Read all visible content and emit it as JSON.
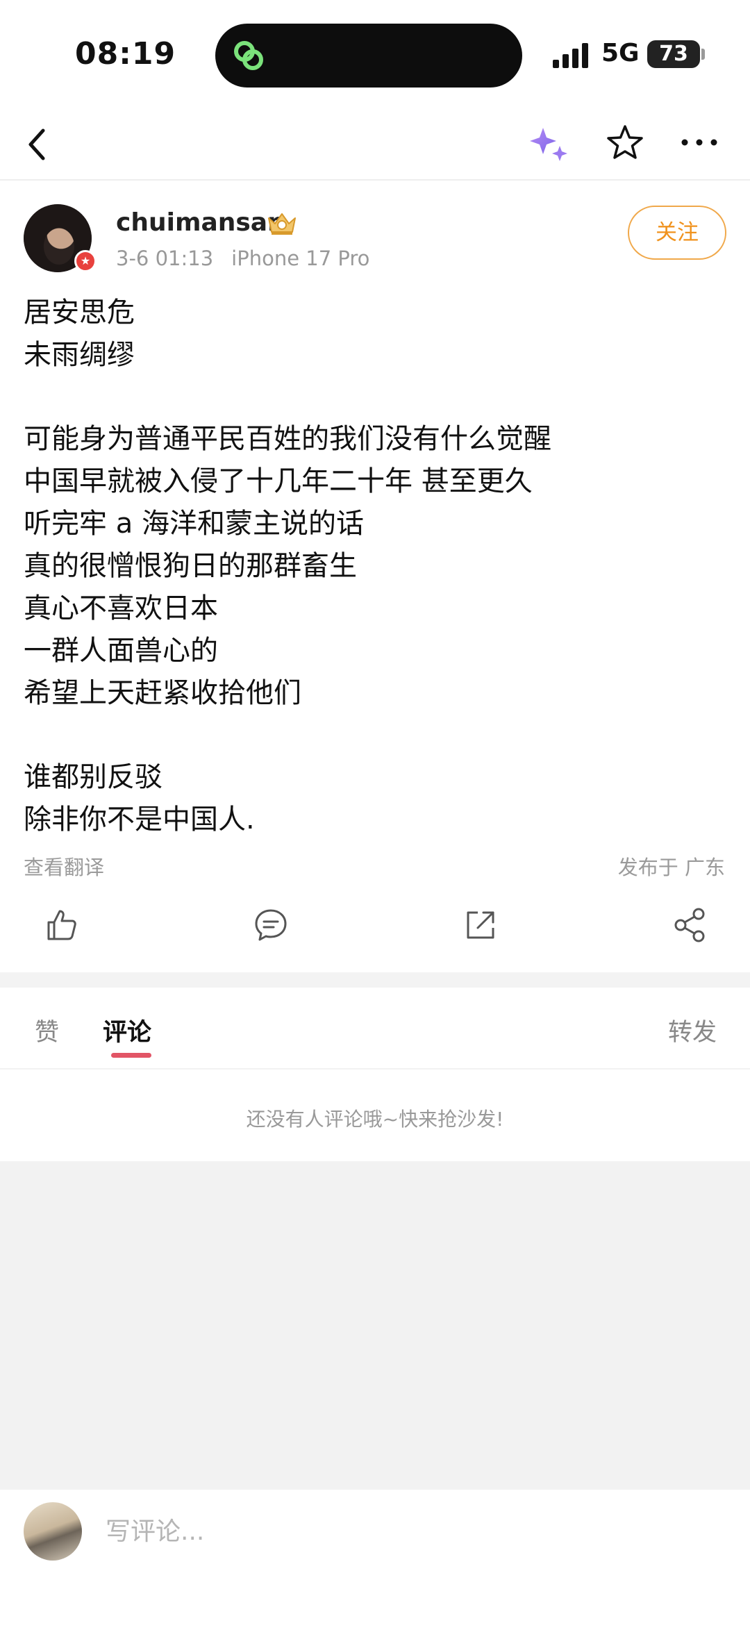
{
  "status_bar": {
    "time": "08:19",
    "network": "5G",
    "battery": "73"
  },
  "nav": {
    "back_icon": "chevron-left-icon",
    "ai_icon": "sparkle-icon",
    "favorite_icon": "star-outline-icon",
    "more_icon": "more-horizontal-icon"
  },
  "post": {
    "username": "chuimansan",
    "date": "3-6 01:13",
    "device": "iPhone 17 Pro",
    "follow_label": "关注",
    "lines": [
      "居安思危",
      "未雨绸缪",
      "",
      "可能身为普通平民百姓的我们没有什么觉醒",
      "中国早就被入侵了十几年二十年 甚至更久",
      "听完牢 a 海洋和蒙主说的话",
      "真的很憎恨狗日的那群畜生",
      "真心不喜欢日本",
      "一群人面兽心的",
      "希望上天赶紧收拾他们",
      "",
      "谁都别反驳",
      "除非你不是中国人."
    ],
    "translate_label": "查看翻译",
    "location": "发布于 广东"
  },
  "actions": {
    "like_icon": "thumb-up-icon",
    "comment_icon": "comment-icon",
    "repost_icon": "share-external-icon",
    "share_icon": "share-nodes-icon"
  },
  "tabs": {
    "likes": "赞",
    "comments": "评论",
    "reposts": "转发"
  },
  "comments": {
    "empty_text": "还没有人评论哦~快来抢沙发!"
  },
  "composer": {
    "placeholder": "写评论..."
  },
  "colors": {
    "follow_accent": "#f0921d",
    "tab_underline": "#e25566",
    "verified_badge": "#e8413d"
  }
}
